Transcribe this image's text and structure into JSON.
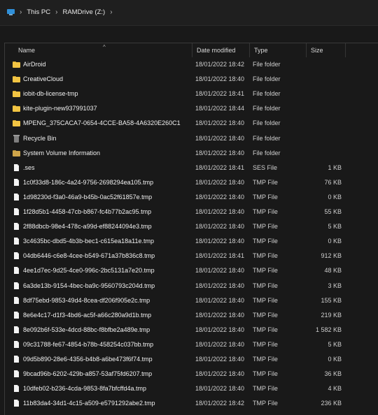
{
  "breadcrumb": {
    "items": [
      "This PC",
      "RAMDrive (Z:)"
    ],
    "separator": "›"
  },
  "columns": {
    "name": "Name",
    "date": "Date modified",
    "type": "Type",
    "size": "Size"
  },
  "files": [
    {
      "name": "AirDroid",
      "date": "18/01/2022 18:42",
      "type": "File folder",
      "size": "",
      "icon": "folder-icon"
    },
    {
      "name": "CreativeCloud",
      "date": "18/01/2022 18:40",
      "type": "File folder",
      "size": "",
      "icon": "folder-icon"
    },
    {
      "name": "iobit-db-license-tmp",
      "date": "18/01/2022 18:41",
      "type": "File folder",
      "size": "",
      "icon": "folder-icon"
    },
    {
      "name": "kite-plugin-new937991037",
      "date": "18/01/2022 18:44",
      "type": "File folder",
      "size": "",
      "icon": "folder-icon"
    },
    {
      "name": "MPENG_375CACA7-0654-4CCE-BA58-4A6320E260C1",
      "date": "18/01/2022 18:40",
      "type": "File folder",
      "size": "",
      "icon": "folder-icon"
    },
    {
      "name": "Recycle Bin",
      "date": "18/01/2022 18:40",
      "type": "File folder",
      "size": "",
      "icon": "recycle-bin-icon"
    },
    {
      "name": "System Volume Information",
      "date": "18/01/2022 18:40",
      "type": "File folder",
      "size": "",
      "icon": "system-folder-icon"
    },
    {
      "name": ".ses",
      "date": "18/01/2022 18:41",
      "type": "SES File",
      "size": "1 KB",
      "icon": "file-icon"
    },
    {
      "name": "1c0f33d8-186c-4a24-9756-2698294ea105.tmp",
      "date": "18/01/2022 18:40",
      "type": "TMP File",
      "size": "76 KB",
      "icon": "file-icon"
    },
    {
      "name": "1d98230d-f3a0-46a9-b45b-0ac52f61857e.tmp",
      "date": "18/01/2022 18:40",
      "type": "TMP File",
      "size": "0 KB",
      "icon": "file-icon"
    },
    {
      "name": "1f28d5b1-4458-47cb-b867-fc4b77b2ac95.tmp",
      "date": "18/01/2022 18:40",
      "type": "TMP File",
      "size": "55 KB",
      "icon": "file-icon"
    },
    {
      "name": "2f88dbcb-98e4-478c-a99d-ef88244094e3.tmp",
      "date": "18/01/2022 18:40",
      "type": "TMP File",
      "size": "5 KB",
      "icon": "file-icon"
    },
    {
      "name": "3c4635bc-dbd5-4b3b-bec1-c615ea18a11e.tmp",
      "date": "18/01/2022 18:40",
      "type": "TMP File",
      "size": "0 KB",
      "icon": "file-icon"
    },
    {
      "name": "04db6446-c6e8-4cee-b549-671a37b836c8.tmp",
      "date": "18/01/2022 18:41",
      "type": "TMP File",
      "size": "912 KB",
      "icon": "file-icon"
    },
    {
      "name": "4ee1d7ec-9d25-4ce0-996c-2bc5131a7e20.tmp",
      "date": "18/01/2022 18:40",
      "type": "TMP File",
      "size": "48 KB",
      "icon": "file-icon"
    },
    {
      "name": "6a3de13b-9154-4bec-ba9c-9560793c204d.tmp",
      "date": "18/01/2022 18:40",
      "type": "TMP File",
      "size": "3 KB",
      "icon": "file-icon"
    },
    {
      "name": "8df75ebd-9853-49d4-8cea-df206f905e2c.tmp",
      "date": "18/01/2022 18:40",
      "type": "TMP File",
      "size": "155 KB",
      "icon": "file-icon"
    },
    {
      "name": "8e6e4c17-d1f3-4bd6-ac5f-a66c280a9d1b.tmp",
      "date": "18/01/2022 18:40",
      "type": "TMP File",
      "size": "219 KB",
      "icon": "file-icon"
    },
    {
      "name": "8e092b6f-533e-4dcd-88bc-f8bfbe2a489e.tmp",
      "date": "18/01/2022 18:40",
      "type": "TMP File",
      "size": "1 582 KB",
      "icon": "file-icon"
    },
    {
      "name": "09c31788-fe67-4854-b78b-458254c037bb.tmp",
      "date": "18/01/2022 18:40",
      "type": "TMP File",
      "size": "5 KB",
      "icon": "file-icon"
    },
    {
      "name": "09d5b890-28e6-4356-b4b8-a6be473f6f74.tmp",
      "date": "18/01/2022 18:40",
      "type": "TMP File",
      "size": "0 KB",
      "icon": "file-icon"
    },
    {
      "name": "9bcad96b-6202-429b-a857-53af75fd6207.tmp",
      "date": "18/01/2022 18:40",
      "type": "TMP File",
      "size": "36 KB",
      "icon": "file-icon"
    },
    {
      "name": "10dfeb02-b236-4cda-9853-8fa7bfcffd4a.tmp",
      "date": "18/01/2022 18:40",
      "type": "TMP File",
      "size": "4 KB",
      "icon": "file-icon"
    },
    {
      "name": "11b83da4-34d1-4c15-a509-e5791292abe2.tmp",
      "date": "18/01/2022 18:42",
      "type": "TMP File",
      "size": "236 KB",
      "icon": "file-icon"
    }
  ]
}
